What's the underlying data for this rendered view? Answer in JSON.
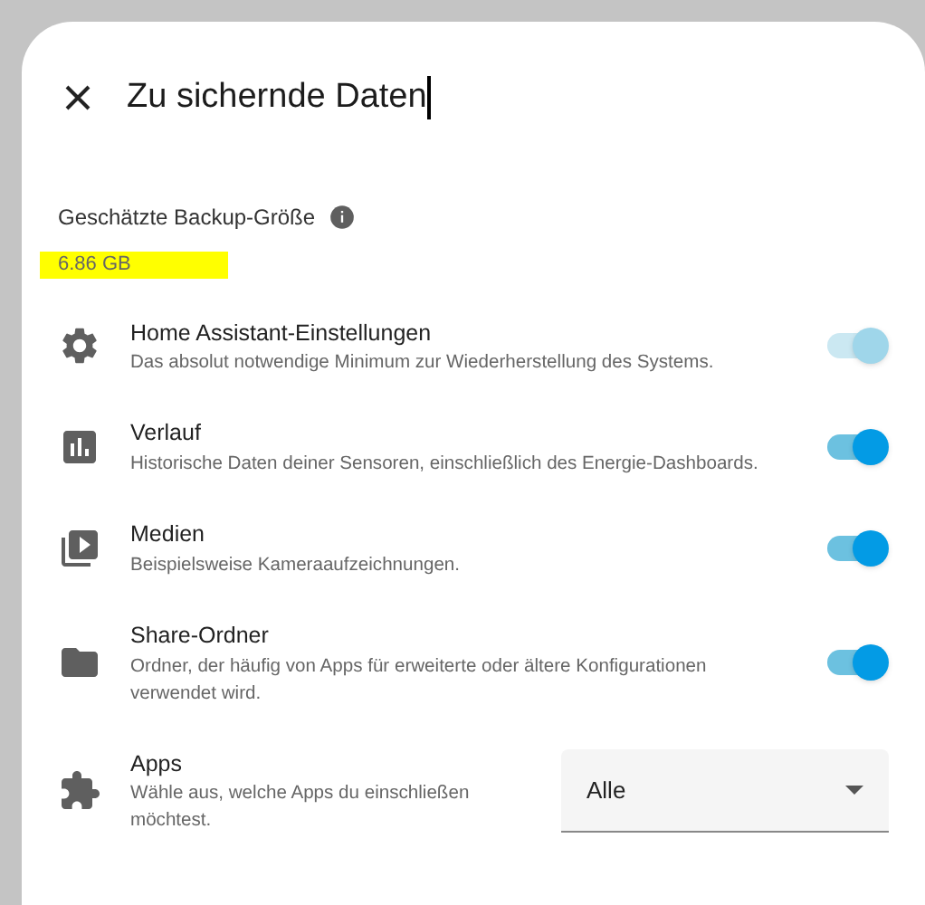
{
  "dialog": {
    "title": "Zu sichernde Daten",
    "text_cursor": true
  },
  "size": {
    "label": "Geschätzte Backup-Größe",
    "value": "6.86 GB",
    "highlighted": true
  },
  "options": [
    {
      "kind": "toggle",
      "title": "Home Assistant-Einstellungen",
      "description": "Das absolut notwendige Minimum zur Wiederherstellung des Systems.",
      "on": true,
      "disabled": true
    },
    {
      "kind": "toggle",
      "title": "Verlauf",
      "description": "Historische Daten deiner Sensoren, einschließlich des Energie-Dashboards.",
      "on": true,
      "disabled": false
    },
    {
      "kind": "toggle",
      "title": "Medien",
      "description": "Beispielsweise Kameraaufzeichnungen.",
      "on": true,
      "disabled": false
    },
    {
      "kind": "toggle",
      "title": "Share-Ordner",
      "description": "Ordner, der häufig von Apps für erweiterte oder ältere Konfigurationen verwendet wird.",
      "on": true,
      "disabled": false
    },
    {
      "kind": "select",
      "title": "Apps",
      "description": "Wähle aus, welche Apps du einschließen möchtest.",
      "value": "Alle"
    }
  ]
}
